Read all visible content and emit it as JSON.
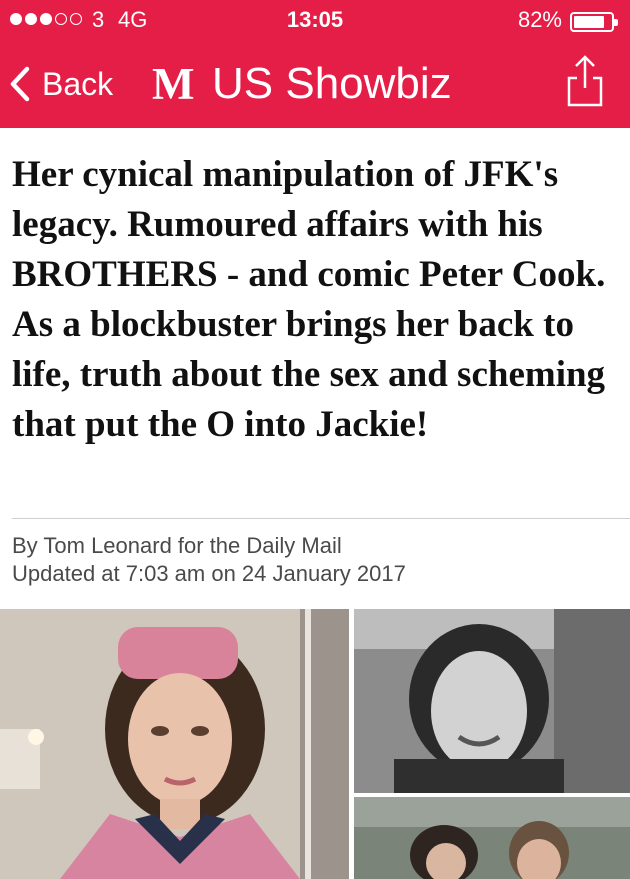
{
  "status_bar": {
    "carrier": "3",
    "network": "4G",
    "time": "13:05",
    "battery_percent": "82%",
    "battery_level": 0.82
  },
  "nav": {
    "back_label": "Back",
    "logo_text": "M",
    "section_title": "US Showbiz",
    "accent_color": "#e51e47"
  },
  "article": {
    "headline": "Her cynical manipulation of JFK's legacy. Rumoured affairs with his BROTHERS - and comic Peter Cook. As a blockbuster brings her back to life, truth about the sex and scheming that put the O into Jackie!",
    "byline": "By Tom Leonard for the Daily Mail",
    "updated": "Updated at 7:03 am on 24 January 2017"
  },
  "icons": {
    "back": "chevron-left-icon",
    "share": "share-icon",
    "battery": "battery-icon",
    "signal": "signal-dots-icon"
  }
}
